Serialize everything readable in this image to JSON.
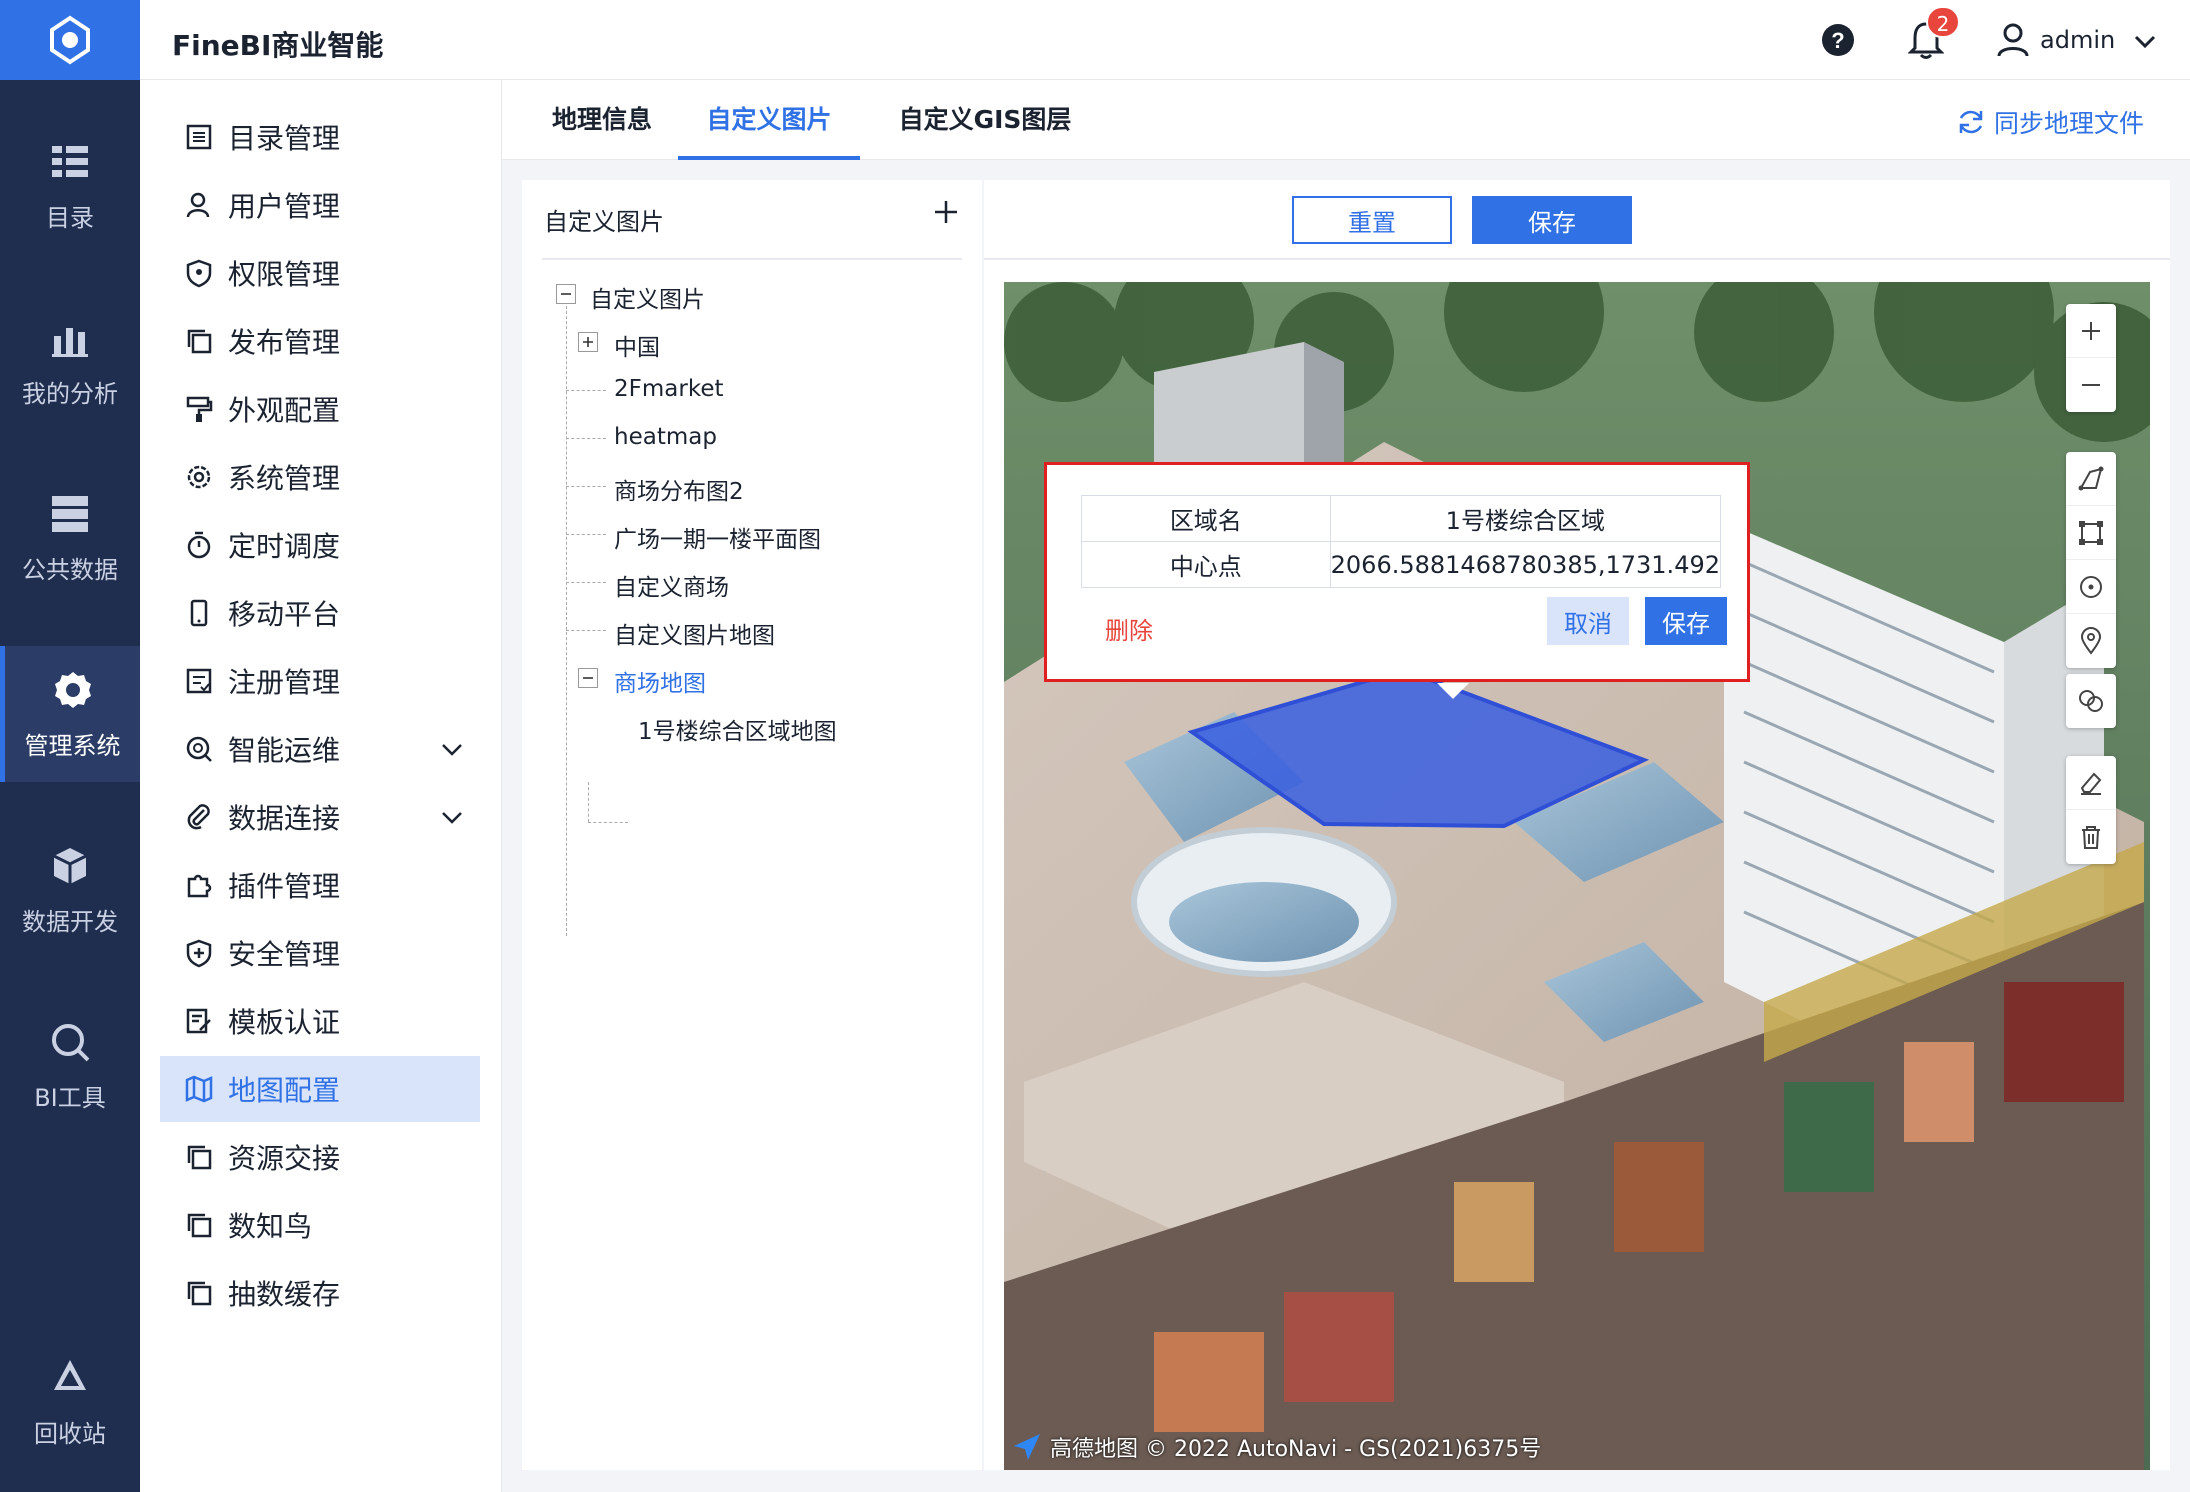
{
  "app": {
    "title": "FineBI商业智能"
  },
  "header": {
    "notification_count": "2",
    "user_name": "admin"
  },
  "leftbar": {
    "items": [
      {
        "label": "目录",
        "icon": "catalog-icon"
      },
      {
        "label": "我的分析",
        "icon": "analysis-icon"
      },
      {
        "label": "公共数据",
        "icon": "database-icon"
      },
      {
        "label": "管理系统",
        "icon": "settings-gear-icon",
        "active": true
      },
      {
        "label": "数据开发",
        "icon": "cube-icon"
      },
      {
        "label": "BI工具",
        "icon": "tool-icon"
      },
      {
        "label": "回收站",
        "icon": "recycle-icon"
      }
    ]
  },
  "sidenav": {
    "items": [
      {
        "label": "目录管理"
      },
      {
        "label": "用户管理"
      },
      {
        "label": "权限管理"
      },
      {
        "label": "发布管理"
      },
      {
        "label": "外观配置"
      },
      {
        "label": "系统管理"
      },
      {
        "label": "定时调度"
      },
      {
        "label": "移动平台"
      },
      {
        "label": "注册管理"
      },
      {
        "label": "智能运维",
        "expandable": true
      },
      {
        "label": "数据连接",
        "expandable": true
      },
      {
        "label": "插件管理"
      },
      {
        "label": "安全管理"
      },
      {
        "label": "模板认证"
      },
      {
        "label": "地图配置",
        "active": true
      },
      {
        "label": "资源交接"
      },
      {
        "label": "数知鸟"
      },
      {
        "label": "抽数缓存"
      }
    ]
  },
  "tabs": [
    {
      "label": "地理信息"
    },
    {
      "label": "自定义图片",
      "active": true
    },
    {
      "label": "自定义GIS图层"
    }
  ],
  "sync_label": "同步地理文件",
  "tree": {
    "title": "自定义图片",
    "root": "自定义图片",
    "nodes": [
      "中国",
      "2Fmarket",
      "heatmap",
      "商场分布图2",
      "广场一期一楼平面图",
      "自定义商场",
      "自定义图片地图",
      "商场地图"
    ],
    "child": "1号楼综合区域地图"
  },
  "map": {
    "reset_label": "重置",
    "save_label": "保存",
    "popup": {
      "rows": [
        {
          "key": "区域名",
          "value": "1号楼综合区域"
        },
        {
          "key": "中心点",
          "value": "2066.5881468780385,1731.492"
        }
      ],
      "delete_label": "删除",
      "cancel_label": "取消",
      "ok_label": "保存"
    },
    "attribution": "高德地图 © 2022 AutoNavi - GS(2021)6375号",
    "colors": {
      "polygon": "#3a5fe0",
      "accent": "#3072e6"
    }
  }
}
